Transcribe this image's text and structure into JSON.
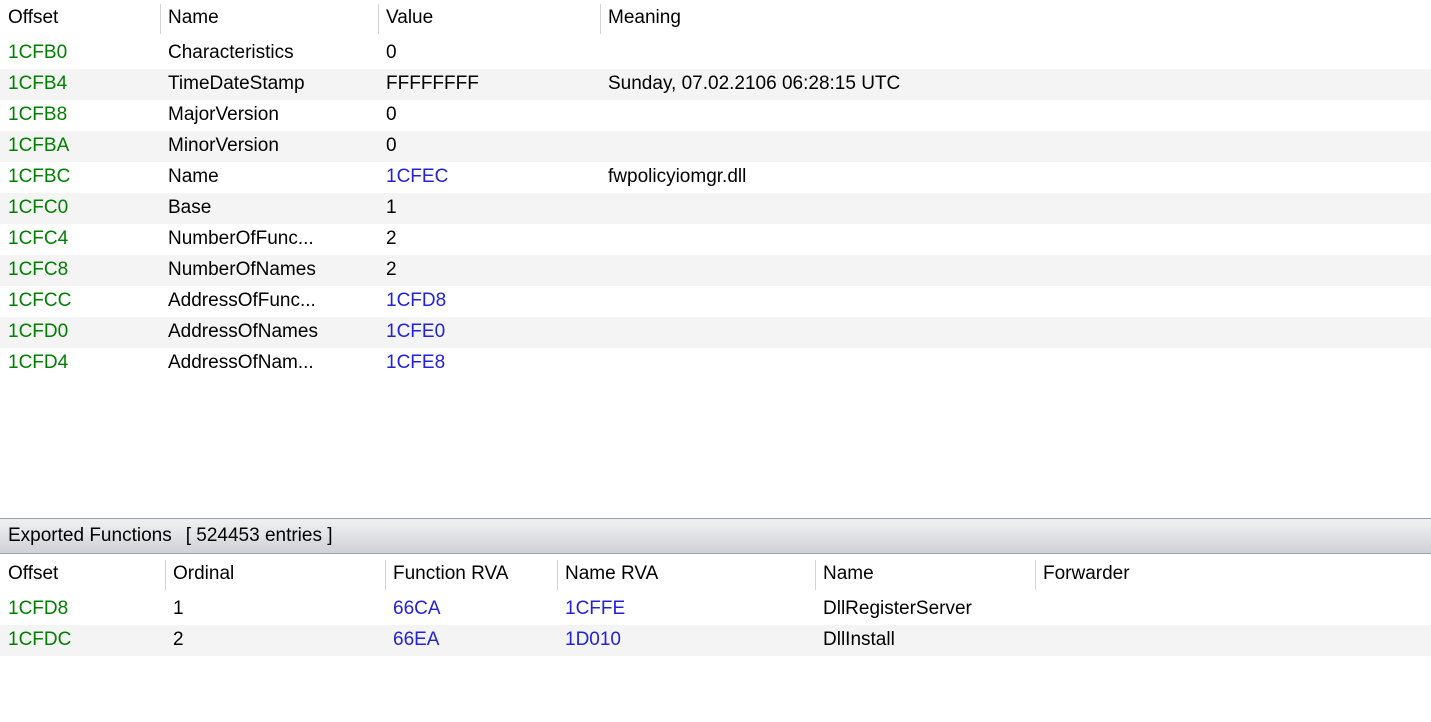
{
  "export_directory": {
    "columns": [
      "Offset",
      "Name",
      "Value",
      "Meaning"
    ],
    "rows": [
      {
        "offset": "1CFB0",
        "name": "Characteristics",
        "value": "0",
        "value_kind": "plain",
        "meaning": ""
      },
      {
        "offset": "1CFB4",
        "name": "TimeDateStamp",
        "value": "FFFFFFFF",
        "value_kind": "plain",
        "meaning": "Sunday, 07.02.2106 06:28:15 UTC"
      },
      {
        "offset": "1CFB8",
        "name": "MajorVersion",
        "value": "0",
        "value_kind": "plain",
        "meaning": ""
      },
      {
        "offset": "1CFBA",
        "name": "MinorVersion",
        "value": "0",
        "value_kind": "plain",
        "meaning": ""
      },
      {
        "offset": "1CFBC",
        "name": "Name",
        "value": "1CFEC",
        "value_kind": "rva",
        "meaning": "fwpolicyiomgr.dll"
      },
      {
        "offset": "1CFC0",
        "name": "Base",
        "value": "1",
        "value_kind": "plain",
        "meaning": ""
      },
      {
        "offset": "1CFC4",
        "name": "NumberOfFunc...",
        "value": "2",
        "value_kind": "plain",
        "meaning": ""
      },
      {
        "offset": "1CFC8",
        "name": "NumberOfNames",
        "value": "2",
        "value_kind": "plain",
        "meaning": ""
      },
      {
        "offset": "1CFCC",
        "name": "AddressOfFunc...",
        "value": "1CFD8",
        "value_kind": "rva",
        "meaning": ""
      },
      {
        "offset": "1CFD0",
        "name": "AddressOfNames",
        "value": "1CFE0",
        "value_kind": "rva",
        "meaning": ""
      },
      {
        "offset": "1CFD4",
        "name": "AddressOfNam...",
        "value": "1CFE8",
        "value_kind": "rva",
        "meaning": ""
      }
    ]
  },
  "exported_functions": {
    "panel_title": "Exported Functions",
    "entries_label": "[ 524453 entries ]",
    "columns": [
      "Offset",
      "Ordinal",
      "Function RVA",
      "Name RVA",
      "Name",
      "Forwarder"
    ],
    "rows": [
      {
        "offset": "1CFD8",
        "ordinal": "1",
        "function_rva": "66CA",
        "name_rva": "1CFFE",
        "name": "DllRegisterServer",
        "forwarder": ""
      },
      {
        "offset": "1CFDC",
        "ordinal": "2",
        "function_rva": "66EA",
        "name_rva": "1D010",
        "name": "DllInstall",
        "forwarder": ""
      }
    ]
  },
  "colors": {
    "offset": "#008000",
    "rva": "#2222dd",
    "text": "#000000",
    "row_alt": "#f4f4f4",
    "panel_border": "#9a9fa8"
  }
}
